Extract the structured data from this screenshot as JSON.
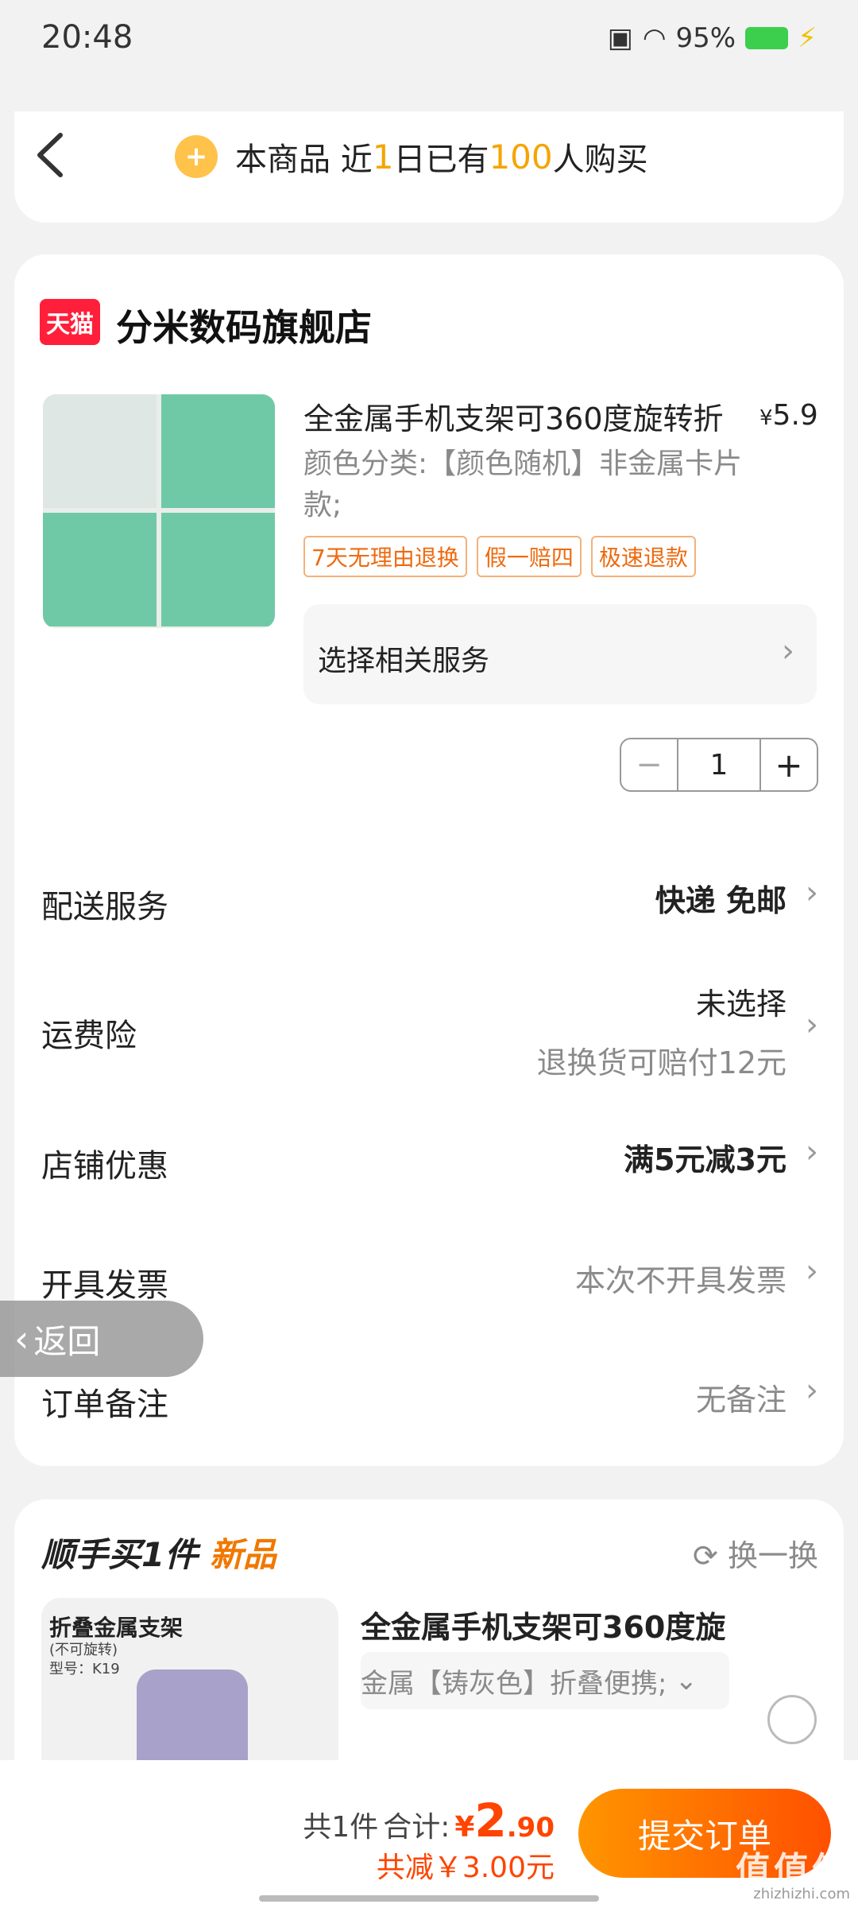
{
  "status_bar": {
    "time": "20:48",
    "battery": "95%"
  },
  "header": {
    "prefix": "本商品 近",
    "days": "1",
    "mid": "日已有",
    "count": "100",
    "suffix": "人购买"
  },
  "store": {
    "logo_text": "天猫",
    "name": "分米数码旗舰店"
  },
  "product": {
    "title": "全金属手机支架可360度旋转折",
    "price_symbol": "¥",
    "price": "5.9",
    "spec": "颜色分类:【颜色随机】非金属卡片款;",
    "tags": [
      "7天无理由退换",
      "假一赔四",
      "极速退款"
    ],
    "service_label": "选择相关服务",
    "quantity": "1"
  },
  "rows": {
    "delivery": {
      "label": "配送服务",
      "value": "快递 免邮"
    },
    "insurance": {
      "label": "运费险",
      "value": "未选择",
      "sub": "退换货可赔付12元"
    },
    "discount": {
      "label": "店铺优惠",
      "value": "满5元减3元"
    },
    "invoice": {
      "label": "开具发票",
      "value": "本次不开具发票"
    },
    "note": {
      "label": "订单备注",
      "value": "无备注"
    }
  },
  "float_back": {
    "label": "返回"
  },
  "addon": {
    "title": "顺手买1件",
    "badge": "新品",
    "refresh": "换一换",
    "img_title": "折叠金属支架",
    "img_sub1": "(不可旋转)",
    "img_sub2": "型号：K19",
    "product_title": "全金属手机支架可360度旋",
    "spec": "金属【铸灰色】折叠便携;"
  },
  "bottom": {
    "count": "共1件",
    "total_label": "合计:",
    "currency": "¥",
    "total_int": "2",
    "total_dec": ".90",
    "reduce": "共减￥3.00元",
    "submit": "提交订单"
  },
  "watermark": {
    "main": "值值值",
    "sub": "zhizhizhi.com"
  },
  "colors": {
    "accent": "#ff5000",
    "price": "#ff4400",
    "highlight": "#f6a400"
  }
}
